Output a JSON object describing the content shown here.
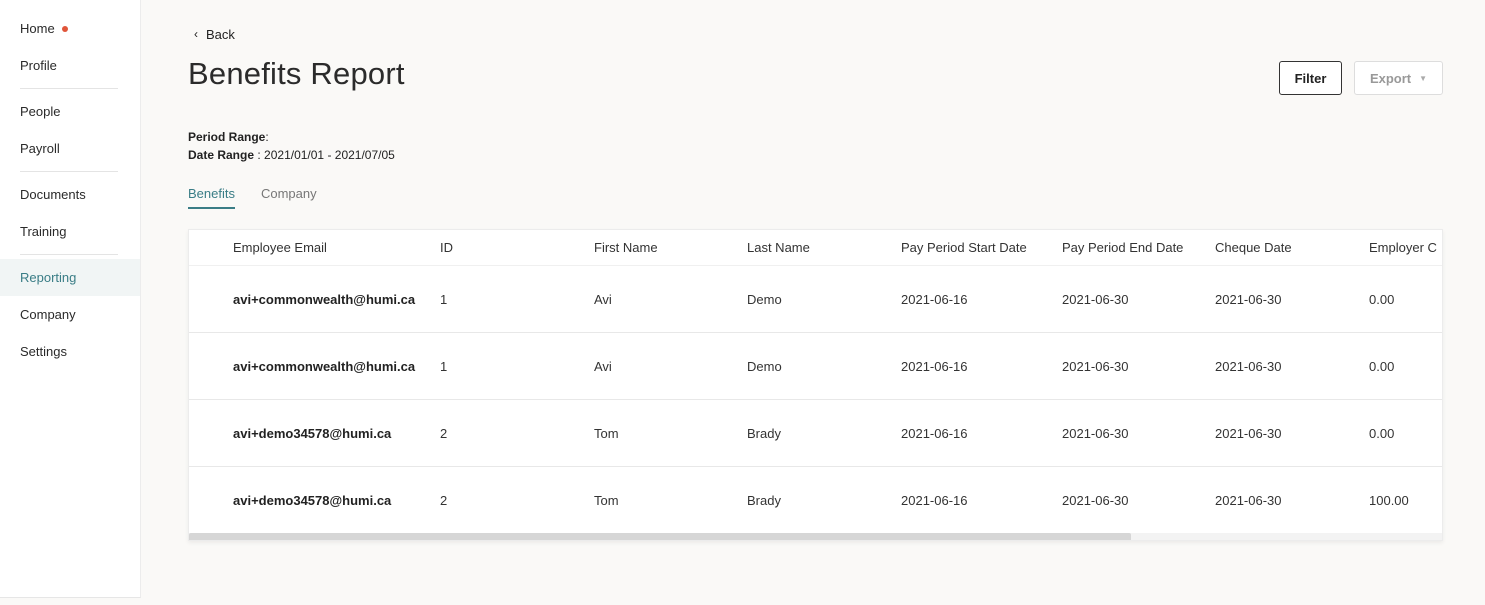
{
  "sidebar": {
    "items": [
      {
        "label": "Home"
      },
      {
        "label": "Profile"
      },
      {
        "label": "People"
      },
      {
        "label": "Payroll"
      },
      {
        "label": "Documents"
      },
      {
        "label": "Training"
      },
      {
        "label": "Reporting"
      },
      {
        "label": "Company"
      },
      {
        "label": "Settings"
      }
    ],
    "active": "Reporting",
    "home_dot_color": "#e0553a"
  },
  "header": {
    "back_label": "Back",
    "title": "Benefits Report",
    "filter_label": "Filter",
    "export_label": "Export"
  },
  "meta": {
    "period_range_label": "Period Range",
    "period_range_value": "",
    "date_range_label": "Date Range",
    "date_range_value": "2021/01/01 - 2021/07/05"
  },
  "tabs": [
    {
      "label": "Benefits",
      "active": true
    },
    {
      "label": "Company",
      "active": false
    }
  ],
  "table": {
    "columns": [
      "Employee Email",
      "ID",
      "First Name",
      "Last Name",
      "Pay Period Start Date",
      "Pay Period End Date",
      "Cheque Date",
      "Employer C"
    ],
    "rows": [
      [
        "avi+commonwealth@humi.ca",
        "1",
        "Avi",
        "Demo",
        "2021-06-16",
        "2021-06-30",
        "2021-06-30",
        "0.00"
      ],
      [
        "avi+commonwealth@humi.ca",
        "1",
        "Avi",
        "Demo",
        "2021-06-16",
        "2021-06-30",
        "2021-06-30",
        "0.00"
      ],
      [
        "avi+demo34578@humi.ca",
        "2",
        "Tom",
        "Brady",
        "2021-06-16",
        "2021-06-30",
        "2021-06-30",
        "0.00"
      ],
      [
        "avi+demo34578@humi.ca",
        "2",
        "Tom",
        "Brady",
        "2021-06-16",
        "2021-06-30",
        "2021-06-30",
        "100.00"
      ]
    ]
  },
  "colors": {
    "accent": "#3a7d86",
    "background": "#faf9f7"
  }
}
